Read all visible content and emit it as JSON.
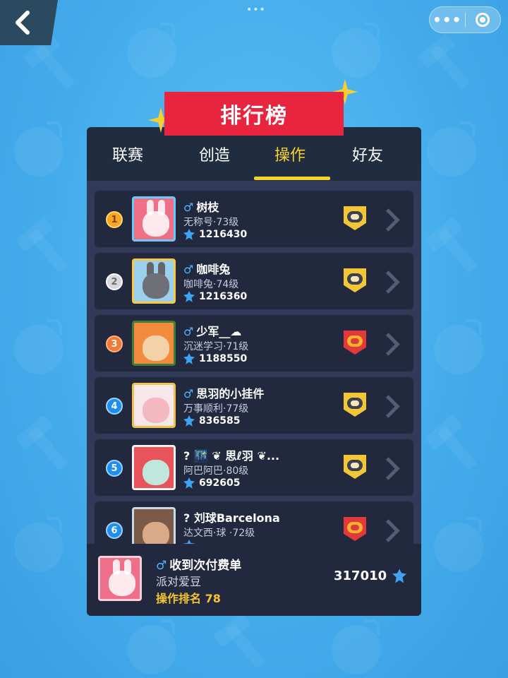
{
  "topbar": {
    "dots": "•••",
    "more": "•••"
  },
  "title": "排行榜",
  "tabs": [
    {
      "label": "联赛"
    },
    {
      "label": "创造"
    },
    {
      "label": "操作"
    },
    {
      "label": "好友"
    }
  ],
  "active_tab": "操作",
  "gender_symbol": "♂",
  "rows": [
    {
      "rank": "1",
      "name": "树枝",
      "subtitle": "无称号·73级",
      "score": "1216430"
    },
    {
      "rank": "2",
      "name": "咖啡兔",
      "subtitle": "咖啡兔·74级",
      "score": "1216360"
    },
    {
      "rank": "3",
      "name": "少军__☁",
      "subtitle": "沉迷学习·71级",
      "score": "1188550"
    },
    {
      "rank": "4",
      "name": "思羽的小挂件",
      "subtitle": "万事顺利·77级",
      "score": "836585"
    },
    {
      "rank": "5",
      "name": "? 🌃 ❦ 思ℓ羽 ❦...",
      "subtitle": "阿巴阿巴·80级",
      "score": "692605"
    },
    {
      "rank": "6",
      "name": "? 刘球Barcelona",
      "subtitle": "达文西·球    ·72级",
      "score": ""
    }
  ],
  "mine": {
    "name": "收到次付费单",
    "subtitle": "派对爱豆",
    "rank_text": "操作排名 78",
    "score": "317010"
  },
  "colors": {
    "accent": "#f6d32b",
    "ribbon": "#e8243e",
    "panel": "#25304a",
    "row": "#22283d",
    "gender": "#4fb4ff"
  }
}
